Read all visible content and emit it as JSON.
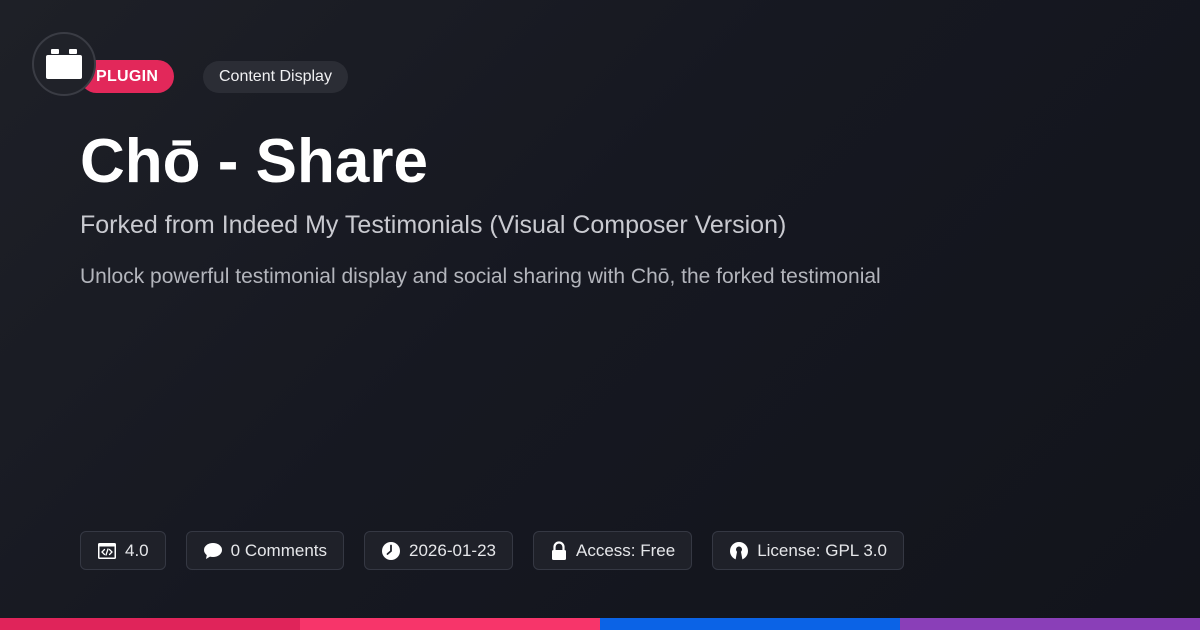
{
  "badge": {
    "type_label": "PLUGIN",
    "category_label": "Content Display"
  },
  "title": "Chō - Share",
  "subtitle": "Forked from Indeed My Testimonials (Visual Composer Version)",
  "description": "Unlock powerful testimonial display and social sharing with Chō, the forked testimonial",
  "meta": {
    "version": "4.0",
    "comments": "0 Comments",
    "date": "2026-01-23",
    "access": "Access: Free",
    "license": "License: GPL 3.0"
  },
  "icons": {
    "logo": "block-icon",
    "version": "code-window-icon",
    "comments": "speech-bubble-icon",
    "date": "clock-icon",
    "access": "lock-icon",
    "license": "open-source-icon"
  },
  "colors": {
    "background": "#161821",
    "plugin_badge": "#e2285a",
    "bottom_bar": [
      "#e0245a",
      "#f7356a",
      "#0b63e6",
      "#8a3fb8"
    ]
  }
}
